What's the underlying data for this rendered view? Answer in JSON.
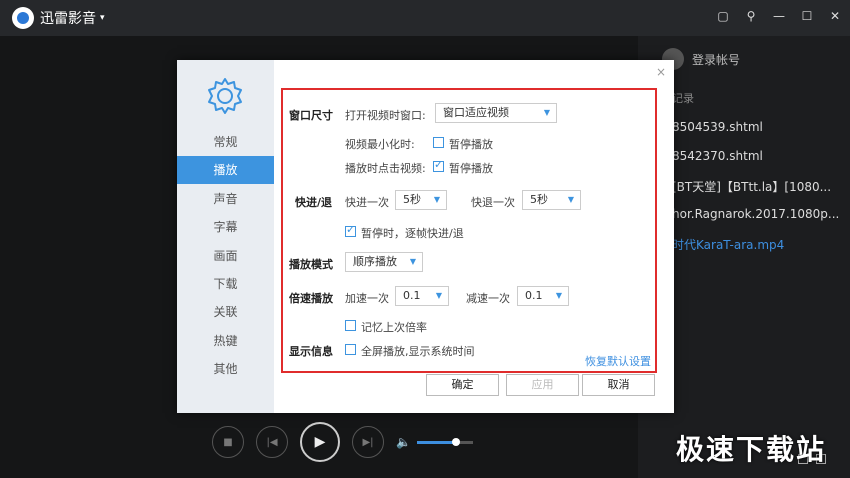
{
  "app": {
    "name": "迅雷影音",
    "caret": "▾"
  },
  "window_buttons": [
    "▢",
    "⚲",
    "—",
    "☐",
    "✕"
  ],
  "playlist": {
    "login": "登录帐号",
    "header": "记录",
    "items": [
      {
        "label": "8504539.shtml",
        "active": false
      },
      {
        "label": "8542370.shtml",
        "active": false
      },
      {
        "label": "[BT天堂]【BTtt.la】[1080...",
        "active": false
      },
      {
        "label": "hor.Ragnarok.2017.1080p...",
        "active": false
      },
      {
        "label": "时代KaraT-ara.mp4",
        "active": true
      }
    ]
  },
  "player": {
    "volume": 0.7
  },
  "watermark": "极速下载站",
  "dialog": {
    "close": "×",
    "nav": [
      "常规",
      "播放",
      "声音",
      "字幕",
      "画面",
      "下载",
      "关联",
      "热键",
      "其他"
    ],
    "active_nav": 1,
    "window_size": {
      "label": "窗口尺寸",
      "open_text": "打开视频时窗口:",
      "open_value": "窗口适应视频",
      "minimize_text": "视频最小化时:",
      "minimize_cb": "暂停播放",
      "minimize_checked": false,
      "click_text": "播放时点击视频:",
      "click_cb": "暂停播放",
      "click_checked": true
    },
    "seek": {
      "label": "快进/退",
      "fwd_text": "快进一次",
      "fwd_value": "5秒",
      "back_text": "快退一次",
      "back_value": "5秒",
      "frame_cb": "暂停时，逐帧快进/退",
      "frame_checked": true
    },
    "mode": {
      "label": "播放模式",
      "value": "顺序播放"
    },
    "speed": {
      "label": "倍速播放",
      "up_text": "加速一次",
      "up_value": "0.1",
      "down_text": "减速一次",
      "down_value": "0.1",
      "remember_cb": "记忆上次倍率",
      "remember_checked": false
    },
    "info": {
      "label": "显示信息",
      "cb": "全屏播放,显示系统时间",
      "checked": false
    },
    "restore": "恢复默认设置",
    "buttons": {
      "ok": "确定",
      "apply": "应用",
      "cancel": "取消"
    }
  }
}
